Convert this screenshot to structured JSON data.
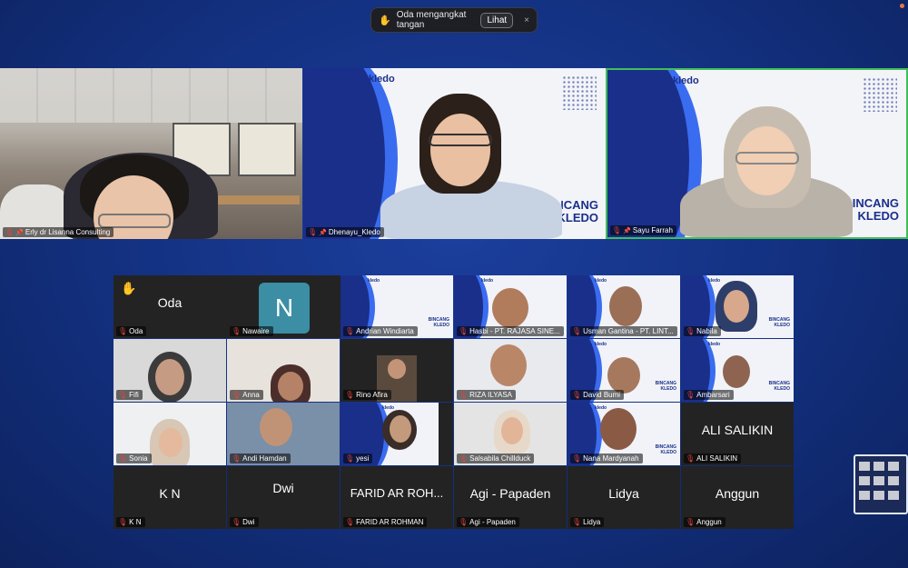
{
  "notification": {
    "text": "Oda mengangkat tangan",
    "action_label": "Lihat",
    "close_label": "×",
    "icon": "raised-hand-icon"
  },
  "speakers": [
    {
      "name": "Erly dr Lisanna Consulting",
      "background": "office"
    },
    {
      "name": "Dhenayu_Kledo",
      "background": "kledo-brand"
    },
    {
      "name": "Sayu Farrah",
      "background": "kledo-brand",
      "active_speaker": true
    }
  ],
  "brand": {
    "logo_text": "kledo",
    "backdrop_text_line1": "BINCANG",
    "backdrop_text_line2": "KLEDO"
  },
  "gallery": [
    {
      "name": "Oda",
      "display": "Oda",
      "hand_raised": true
    },
    {
      "name": "Nawaire",
      "avatar_letter": "N"
    },
    {
      "name": "Andrian Windiarta"
    },
    {
      "name": "Hasbi - PT. RAJASA SINE..."
    },
    {
      "name": "Usman Gantina - PT. LINT..."
    },
    {
      "name": "Nabila"
    },
    {
      "name": "Fifi"
    },
    {
      "name": "Anna"
    },
    {
      "name": "Rino Afira"
    },
    {
      "name": "RIZA ILYASA"
    },
    {
      "name": "David Bumi"
    },
    {
      "name": "Ambarsari"
    },
    {
      "name": "Sonia"
    },
    {
      "name": "Andi Hamdan"
    },
    {
      "name": "yesi"
    },
    {
      "name": "Salsabila Chillduck"
    },
    {
      "name": "Nana Mardyanah"
    },
    {
      "name": "ALI SALIKIN",
      "display": "ALI SALIKIN"
    },
    {
      "name": "K N",
      "display": "K N"
    },
    {
      "name": "Dwi",
      "display": "Dwi"
    },
    {
      "name": "FARID AR ROHMAN",
      "display": "FARID AR ROH..."
    },
    {
      "name": "Agi - Papaden",
      "display": "Agi - Papaden"
    },
    {
      "name": "Lidya",
      "display": "Lidya"
    },
    {
      "name": "Anggun",
      "display": "Anggun"
    }
  ],
  "colors": {
    "background": "#13307f",
    "active_speaker_border": "#3fbf58",
    "muted_mic": "#e0453a",
    "brand_blue": "#1a2f8a"
  }
}
